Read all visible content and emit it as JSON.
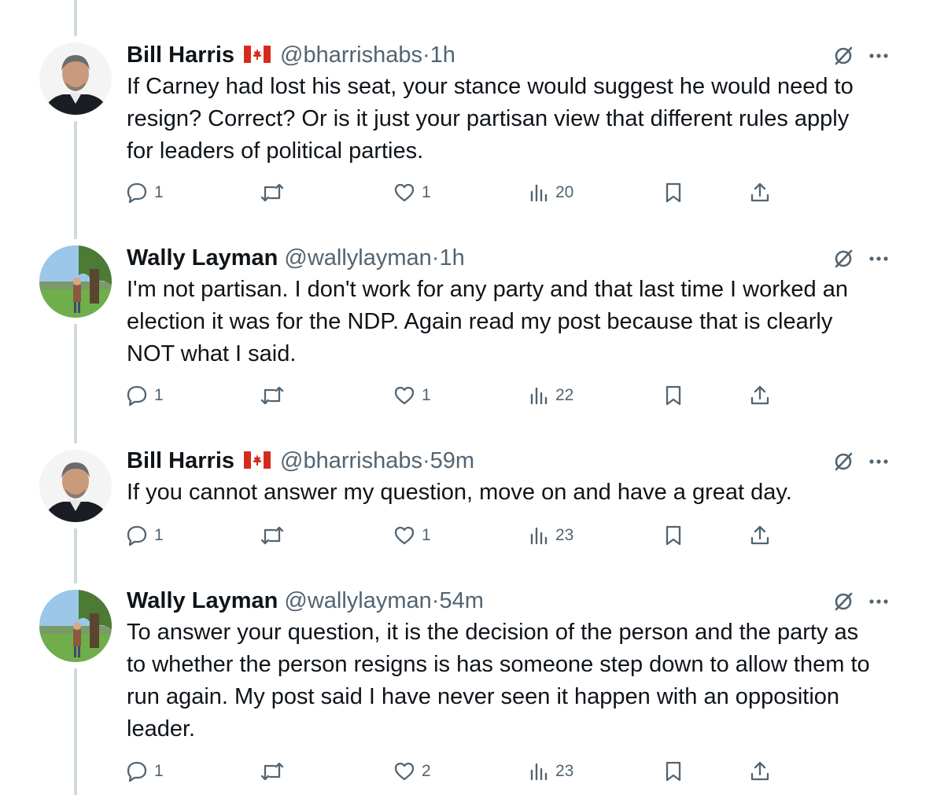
{
  "thread": [
    {
      "author": "Bill Harris",
      "has_flag": true,
      "handle": "@bharrishabs",
      "time": "1h",
      "text": "If Carney had lost his seat, your stance would suggest he would need to resign? Correct? Or is it just your partisan view that different rules apply for leaders of political parties.",
      "replies": "1",
      "reposts": "",
      "likes": "1",
      "views": "20"
    },
    {
      "author": "Wally Layman",
      "has_flag": false,
      "handle": "@wallylayman",
      "time": "1h",
      "text": "I'm not partisan. I don't work for any party and that last time I worked an election it was for the NDP. Again read my post because that is clearly NOT what I said.",
      "replies": "1",
      "reposts": "",
      "likes": "1",
      "views": "22"
    },
    {
      "author": "Bill Harris",
      "has_flag": true,
      "handle": "@bharrishabs",
      "time": "59m",
      "text": "If you cannot answer my question, move on and have a great day.",
      "replies": "1",
      "reposts": "",
      "likes": "1",
      "views": "23"
    },
    {
      "author": "Wally Layman",
      "has_flag": false,
      "handle": "@wallylayman",
      "time": "54m",
      "text": "To answer your question, it is the decision of the person and the party as to whether the person resigns is has someone step down to allow them to run again. My post said I have never seen it happen with an opposition leader.",
      "replies": "1",
      "reposts": "",
      "likes": "2",
      "views": "23"
    }
  ],
  "separator": "·",
  "icons": {
    "reply": "reply-icon",
    "repost": "repost-icon",
    "like": "heart-icon",
    "views": "views-bar-chart-icon",
    "bookmark": "bookmark-icon",
    "share": "share-icon",
    "grok": "grok-slash-icon",
    "more": "more-dots-icon",
    "flag": "canada-flag-icon"
  },
  "colors": {
    "text": "#0f1419",
    "secondary": "#536471",
    "thread_line": "#cfd9de",
    "flag_red": "#d52b1e"
  }
}
